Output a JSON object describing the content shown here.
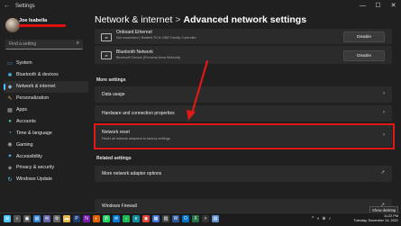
{
  "window": {
    "app_title": "Settings",
    "controls": [
      "—",
      "☐",
      "✕"
    ]
  },
  "sidebar": {
    "user_name": "Joe Isabella",
    "search_placeholder": "Find a setting",
    "items": [
      {
        "label": "System",
        "icon": "monitor-icon",
        "glyph": "▭",
        "color": "#4cc2ff"
      },
      {
        "label": "Bluetooth & devices",
        "icon": "bluetooth-icon",
        "glyph": "✱",
        "color": "#4cc2ff"
      },
      {
        "label": "Network & internet",
        "icon": "wifi-icon",
        "glyph": "◆",
        "color": "#9ab3d5",
        "active": true
      },
      {
        "label": "Personalization",
        "icon": "brush-icon",
        "glyph": "✎",
        "color": "#e0a060"
      },
      {
        "label": "Apps",
        "icon": "apps-icon",
        "glyph": "▦",
        "color": "#aaaaaa"
      },
      {
        "label": "Accounts",
        "icon": "person-icon",
        "glyph": "●",
        "color": "#5ec486"
      },
      {
        "label": "Time & language",
        "icon": "clock-globe-icon",
        "glyph": "◔",
        "color": "#4cc2ff"
      },
      {
        "label": "Gaming",
        "icon": "controller-icon",
        "glyph": "◉",
        "color": "#aaaaaa"
      },
      {
        "label": "Accessibility",
        "icon": "accessibility-icon",
        "glyph": "✦",
        "color": "#4cc2ff"
      },
      {
        "label": "Privacy & security",
        "icon": "shield-icon",
        "glyph": "◈",
        "color": "#aaaaaa"
      },
      {
        "label": "Windows Update",
        "icon": "update-icon",
        "glyph": "↻",
        "color": "#4cc2ff"
      }
    ]
  },
  "breadcrumb": {
    "parent": "Network & internet",
    "separator": ">",
    "current": "Advanced network settings"
  },
  "adapters": [
    {
      "name": "Onboard Ethernet",
      "description": "Not connected | Realtek PCIe GBE Family Controller",
      "button": "Disable"
    },
    {
      "name": "Bluetooth Network",
      "description": "Bluetooth Device (Personal Area Network)",
      "button": "Disable"
    }
  ],
  "more_settings": {
    "heading": "More settings",
    "items": [
      {
        "label": "Data usage"
      },
      {
        "label": "Hardware and connection properties"
      }
    ],
    "network_reset": {
      "label": "Network reset",
      "description": "Reset all network adapters to factory settings"
    }
  },
  "related_settings": {
    "heading": "Related settings",
    "items": [
      {
        "label": "More network adapter options"
      },
      {
        "label": "Windows Firewall"
      }
    ]
  },
  "tooltip": "Show desktop",
  "taskbar": {
    "icons": [
      {
        "name": "start-icon",
        "glyph": "⊞",
        "color": "#4cc2ff"
      },
      {
        "name": "search-icon",
        "glyph": "⌕",
        "color": "#555"
      },
      {
        "name": "task-view-icon",
        "glyph": "▣",
        "color": "#555"
      },
      {
        "name": "widgets-icon",
        "glyph": "▤",
        "color": "#2f7fd0"
      },
      {
        "name": "chat-icon",
        "glyph": "✉",
        "color": "#6264a7"
      },
      {
        "name": "settings-icon",
        "glyph": "⚙",
        "color": "#666"
      },
      {
        "name": "file-explorer-icon",
        "glyph": "▬",
        "color": "#e8b84a"
      },
      {
        "name": "photoshop-icon",
        "glyph": "P",
        "color": "#1d3c72"
      },
      {
        "name": "onenote-icon",
        "glyph": "N",
        "color": "#7719aa"
      },
      {
        "name": "firefox-icon",
        "glyph": "◐",
        "color": "#e66000"
      },
      {
        "name": "whatsapp-icon",
        "glyph": "✆",
        "color": "#25d366"
      },
      {
        "name": "mail-icon",
        "glyph": "✉",
        "color": "#0078d4"
      },
      {
        "name": "music-icon",
        "glyph": "♪",
        "color": "#1db954"
      },
      {
        "name": "edge-icon",
        "glyph": "e",
        "color": "#0c8f9c"
      },
      {
        "name": "chrome-icon",
        "glyph": "◉",
        "color": "#db4437"
      },
      {
        "name": "store-icon",
        "glyph": "▦",
        "color": "#3a6fd8"
      },
      {
        "name": "calculator-icon",
        "glyph": "▥",
        "color": "#444"
      },
      {
        "name": "word-icon",
        "glyph": "W",
        "color": "#2b579a"
      },
      {
        "name": "outlook-icon",
        "glyph": "O",
        "color": "#0072c6"
      },
      {
        "name": "excel-icon",
        "glyph": "X",
        "color": "#217346"
      },
      {
        "name": "terminal-icon",
        "glyph": ">",
        "color": "#333"
      },
      {
        "name": "notepad-icon",
        "glyph": "▤",
        "color": "#5b8fd0"
      }
    ],
    "tray": [
      "^",
      "◖",
      "⊕",
      "♪"
    ],
    "time": "11:22 PM",
    "date": "Tuesday, December 14, 2021"
  },
  "colors": {
    "accent": "#4cc2ff",
    "highlight": "#e01818"
  }
}
